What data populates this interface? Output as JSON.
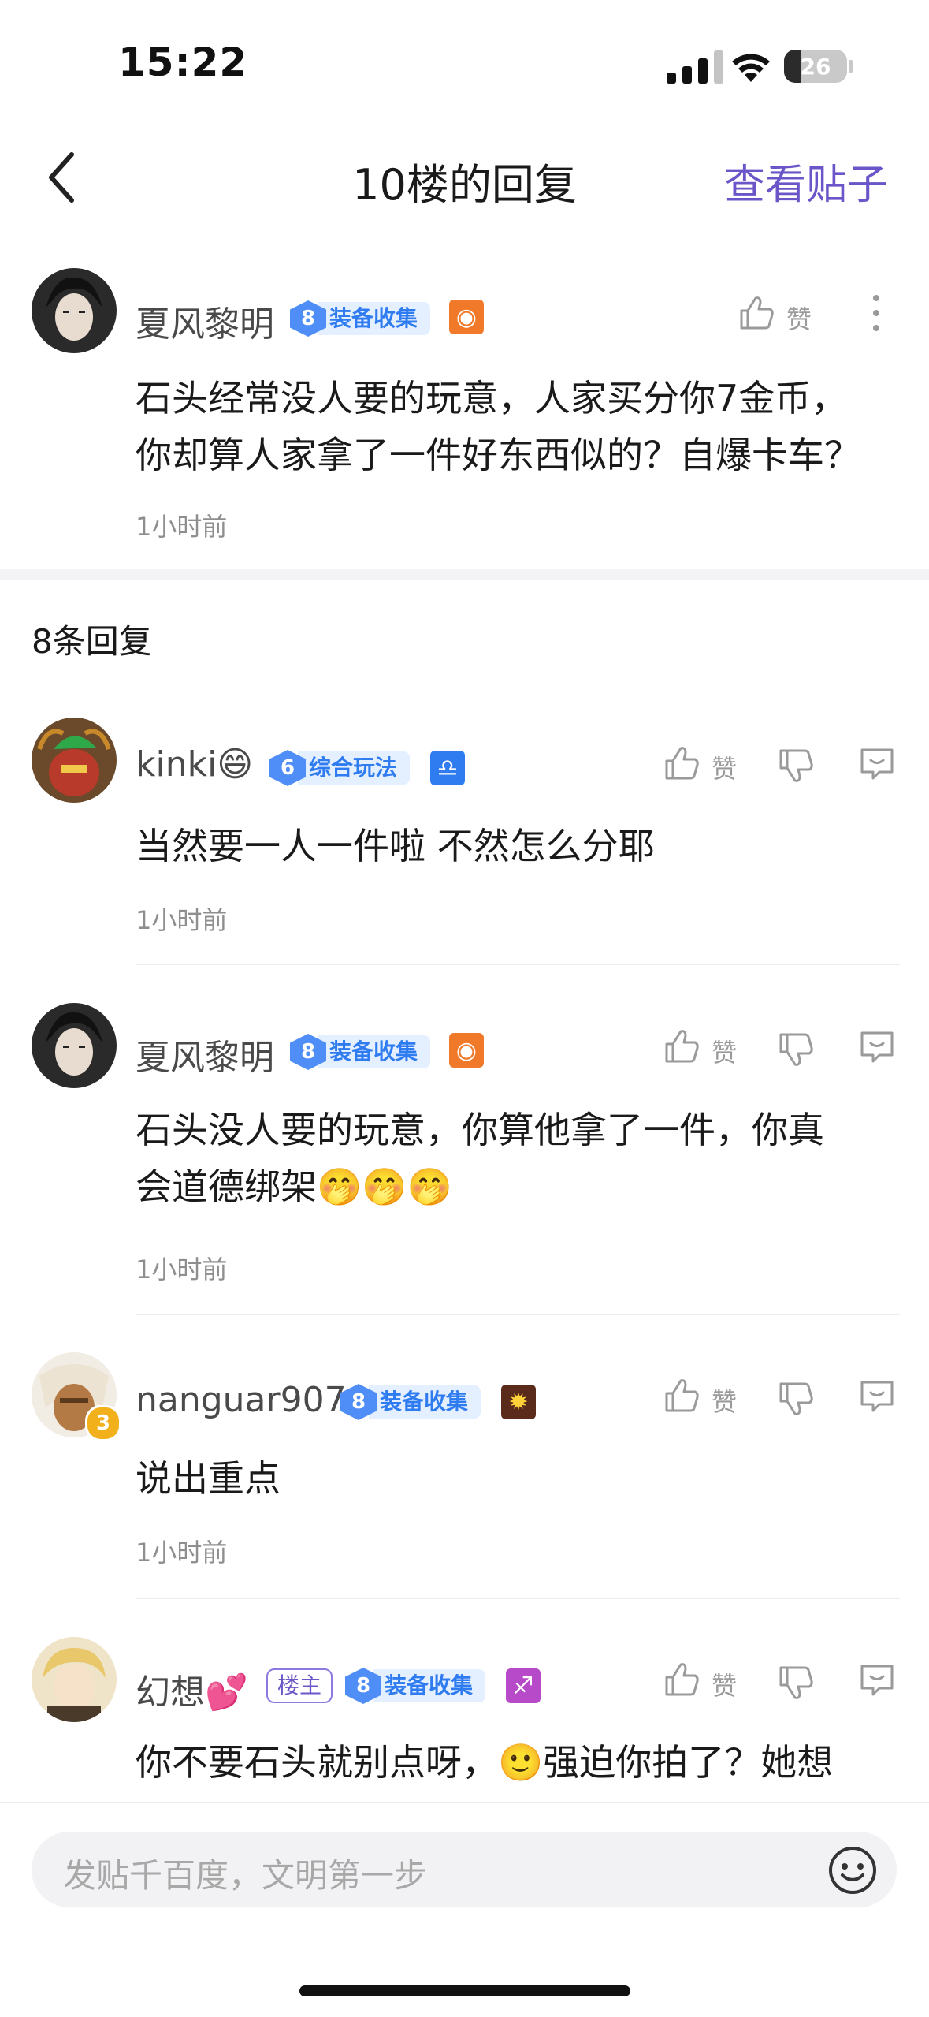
{
  "status": {
    "time": "15:22",
    "battery": "26",
    "battery_level": 0.26
  },
  "header": {
    "title": "10楼的回复",
    "view_post": "查看贴子"
  },
  "main_post": {
    "username": "夏风黎明",
    "level": "8",
    "level_tag": "装备收集",
    "badge_icon": "flame-face-icon",
    "like_label": "赞",
    "text_lines": [
      "石头经常没人要的玩意，人家买分你7金币，",
      "你却算人家拿了一件好东西似的？自爆卡车？"
    ],
    "time": "1小时前"
  },
  "reply_count": "8条回复",
  "replies": [
    {
      "username": "kinki😄",
      "level": "6",
      "level_tag": "综合玩法",
      "badge_icon": "libra-icon",
      "text_lines": [
        "当然要一人一件啦 不然怎么分耶"
      ],
      "time": "1小时前",
      "like_label": "赞"
    },
    {
      "username": "夏风黎明",
      "level": "8",
      "level_tag": "装备收集",
      "badge_icon": "flame-face-icon",
      "text_lines": [
        "石头没人要的玩意，你算他拿了一件，你真",
        "会道德绑架🤭🤭🤭"
      ],
      "time": "1小时前",
      "like_label": "赞"
    },
    {
      "username": "nanguar907",
      "level": "8",
      "level_tag": "装备收集",
      "badge_icon": "sun-icon",
      "avatar_badge": "3",
      "text_lines": [
        "说出重点"
      ],
      "time": "1小时前",
      "like_label": "赞"
    },
    {
      "username": "幻想💕",
      "owner_tag": "楼主",
      "level": "8",
      "level_tag": "装备收集",
      "badge_icon": "sagittarius-icon",
      "text_lines": [
        "你不要石头就别点呀，🙂强迫你拍了？她想"
      ],
      "like_label": "赞"
    }
  ],
  "input": {
    "placeholder": "发贴千百度，文明第一步"
  },
  "colors": {
    "accent": "#6b55c8",
    "level_blue": "#4f8ef7",
    "tag_bg": "#e4efff"
  }
}
